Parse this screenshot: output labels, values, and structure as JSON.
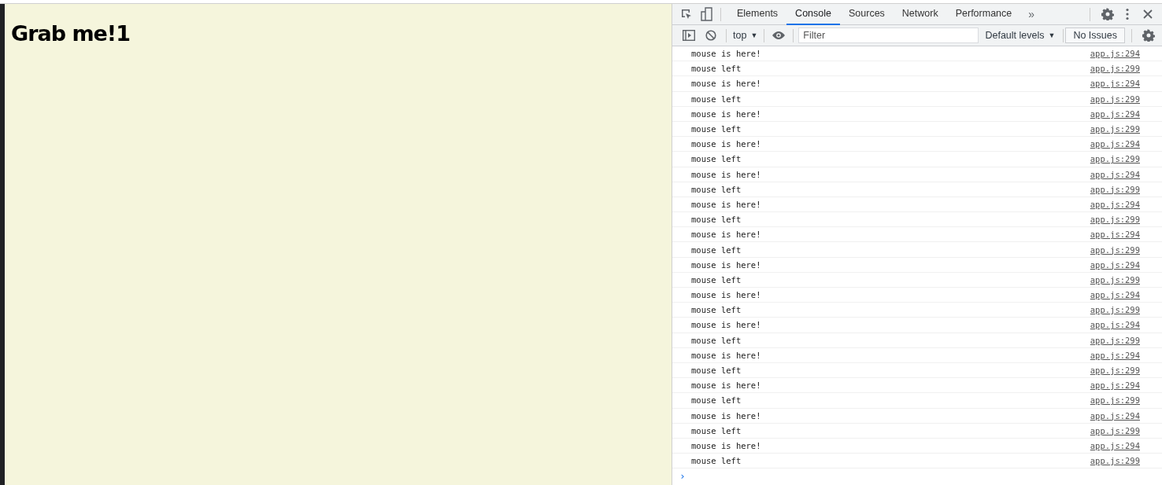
{
  "page": {
    "heading": "Grab me!1"
  },
  "devtools": {
    "tabs": [
      {
        "label": "Elements",
        "selected": false
      },
      {
        "label": "Console",
        "selected": true
      },
      {
        "label": "Sources",
        "selected": false
      },
      {
        "label": "Network",
        "selected": false
      },
      {
        "label": "Performance",
        "selected": false
      }
    ],
    "more_tabs": "»",
    "console_toolbar": {
      "context": "top",
      "context_caret": "▼",
      "filter": {
        "placeholder": "Filter"
      },
      "levels": "Default levels",
      "levels_caret": "▼",
      "issues": "No Issues"
    },
    "messages": [
      {
        "text": "mouse is here!",
        "source": "app.js:294"
      },
      {
        "text": "mouse left",
        "source": "app.js:299"
      },
      {
        "text": "mouse is here!",
        "source": "app.js:294"
      },
      {
        "text": "mouse left",
        "source": "app.js:299"
      },
      {
        "text": "mouse is here!",
        "source": "app.js:294"
      },
      {
        "text": "mouse left",
        "source": "app.js:299"
      },
      {
        "text": "mouse is here!",
        "source": "app.js:294"
      },
      {
        "text": "mouse left",
        "source": "app.js:299"
      },
      {
        "text": "mouse is here!",
        "source": "app.js:294"
      },
      {
        "text": "mouse left",
        "source": "app.js:299"
      },
      {
        "text": "mouse is here!",
        "source": "app.js:294"
      },
      {
        "text": "mouse left",
        "source": "app.js:299"
      },
      {
        "text": "mouse is here!",
        "source": "app.js:294"
      },
      {
        "text": "mouse left",
        "source": "app.js:299"
      },
      {
        "text": "mouse is here!",
        "source": "app.js:294"
      },
      {
        "text": "mouse left",
        "source": "app.js:299"
      },
      {
        "text": "mouse is here!",
        "source": "app.js:294"
      },
      {
        "text": "mouse left",
        "source": "app.js:299"
      },
      {
        "text": "mouse is here!",
        "source": "app.js:294"
      },
      {
        "text": "mouse left",
        "source": "app.js:299"
      },
      {
        "text": "mouse is here!",
        "source": "app.js:294"
      },
      {
        "text": "mouse left",
        "source": "app.js:299"
      },
      {
        "text": "mouse is here!",
        "source": "app.js:294"
      },
      {
        "text": "mouse left",
        "source": "app.js:299"
      },
      {
        "text": "mouse is here!",
        "source": "app.js:294"
      },
      {
        "text": "mouse left",
        "source": "app.js:299"
      },
      {
        "text": "mouse is here!",
        "source": "app.js:294"
      },
      {
        "text": "mouse left",
        "source": "app.js:299"
      }
    ],
    "prompt": "›"
  }
}
